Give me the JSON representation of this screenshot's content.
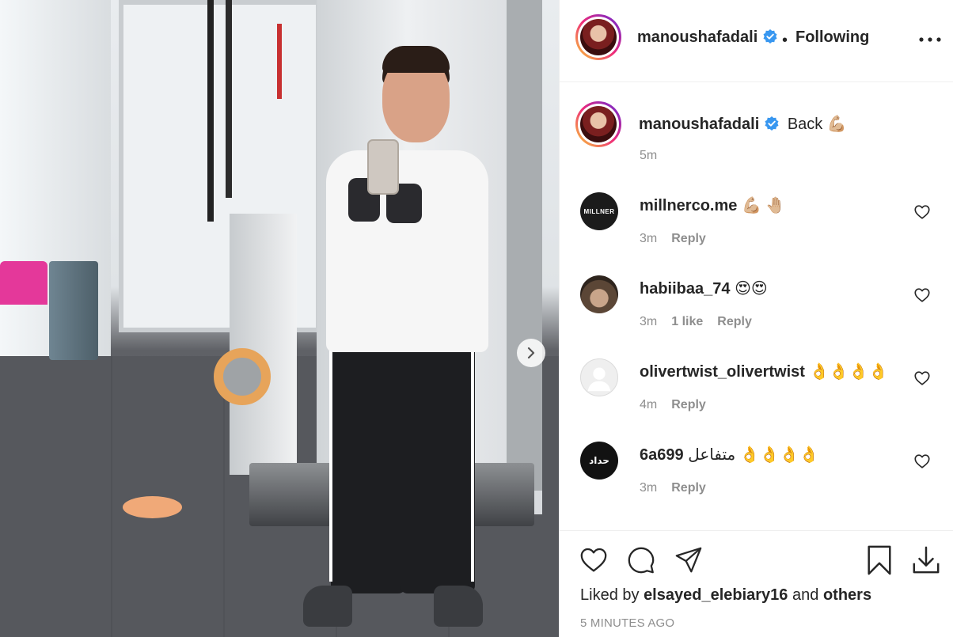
{
  "post": {
    "author": "manoushafadali",
    "follow_separator": "•",
    "follow_label": "Following",
    "caption_user": "manoushafadali",
    "caption_text": "Back 💪🏼",
    "caption_time": "5m"
  },
  "comments": [
    {
      "user": "millnerco.me",
      "text": "💪🏼 🤚🏼",
      "time": "3m",
      "likes": "",
      "reply": "Reply",
      "avatar_text": "MILLNER"
    },
    {
      "user": "habiibaa_74",
      "text": "😍😍",
      "time": "3m",
      "likes": "1 like",
      "reply": "Reply",
      "avatar_text": ""
    },
    {
      "user": "olivertwist_olivertwist",
      "text": "👌👌👌👌",
      "time": "4m",
      "likes": "",
      "reply": "Reply",
      "avatar_text": ""
    },
    {
      "user": "6a699",
      "text": "متفاعل 👌👌👌👌",
      "time": "3m",
      "likes": "",
      "reply": "Reply",
      "avatar_text": "حداد"
    }
  ],
  "footer": {
    "liked_prefix": "Liked by",
    "liked_user": "elsayed_elebiary16",
    "liked_and": "and",
    "liked_others": "others",
    "posted_ago": "5 MINUTES AGO"
  },
  "colors": {
    "verified": "#3897f0",
    "secondary_text": "#8e8e8e",
    "text": "#262626"
  }
}
